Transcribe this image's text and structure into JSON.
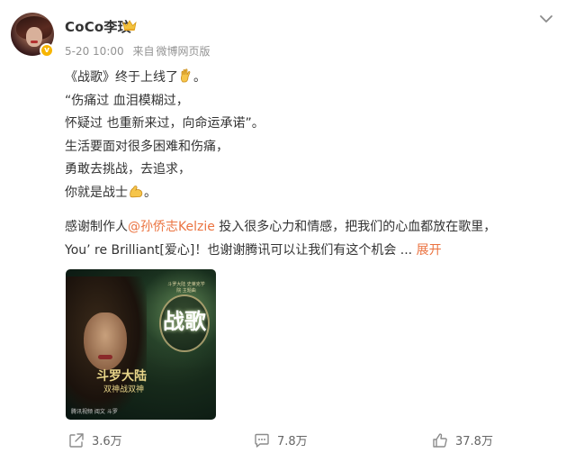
{
  "post": {
    "author": "CoCo李玟",
    "timestamp": "5-20 10:00",
    "source_prefix": "来自",
    "source": "微博网页版",
    "verified_badge": "v",
    "lines": [
      "《战歌》终于上线了",
      "“伤痛过 血泪模糊过，",
      "怀疑过 也重新来过，向命运承诺”。",
      "生活要面对很多困难和伤痛，",
      "勇敢去挑战，去追求，",
      "你就是战士"
    ],
    "line1_suffix": "。",
    "line6_suffix": "。",
    "thanks_prefix": "感谢制作人",
    "mention": "@孙侨志Kelzie",
    "thanks_suffix": " 投入很多心力和情感，把我们的心血都放在歌里，",
    "last_line": "You’ re Brilliant[爱心]！也谢谢腾讯可以让我们有这个机会 ...",
    "expand_label": "展开"
  },
  "media": {
    "logo_text": "战歌",
    "top_small_text": "斗罗大陆 史莱克学院 主题曲",
    "sub_logo": "斗罗大陆",
    "sub_logo2": "双神战双神",
    "bottom_text": "腾讯视频  阅文  斗罗"
  },
  "actions": {
    "share_count": "3.6万",
    "comment_count": "7.8万",
    "like_count": "37.8万"
  },
  "colors": {
    "accent": "#eb7340",
    "meta_gray": "#939393",
    "verified": "#f7b500"
  },
  "icons": [
    "crown-icon",
    "chevron-down-icon",
    "ok-hand-emoji-icon",
    "flexed-biceps-emoji-icon",
    "share-icon",
    "comment-icon",
    "like-icon"
  ]
}
